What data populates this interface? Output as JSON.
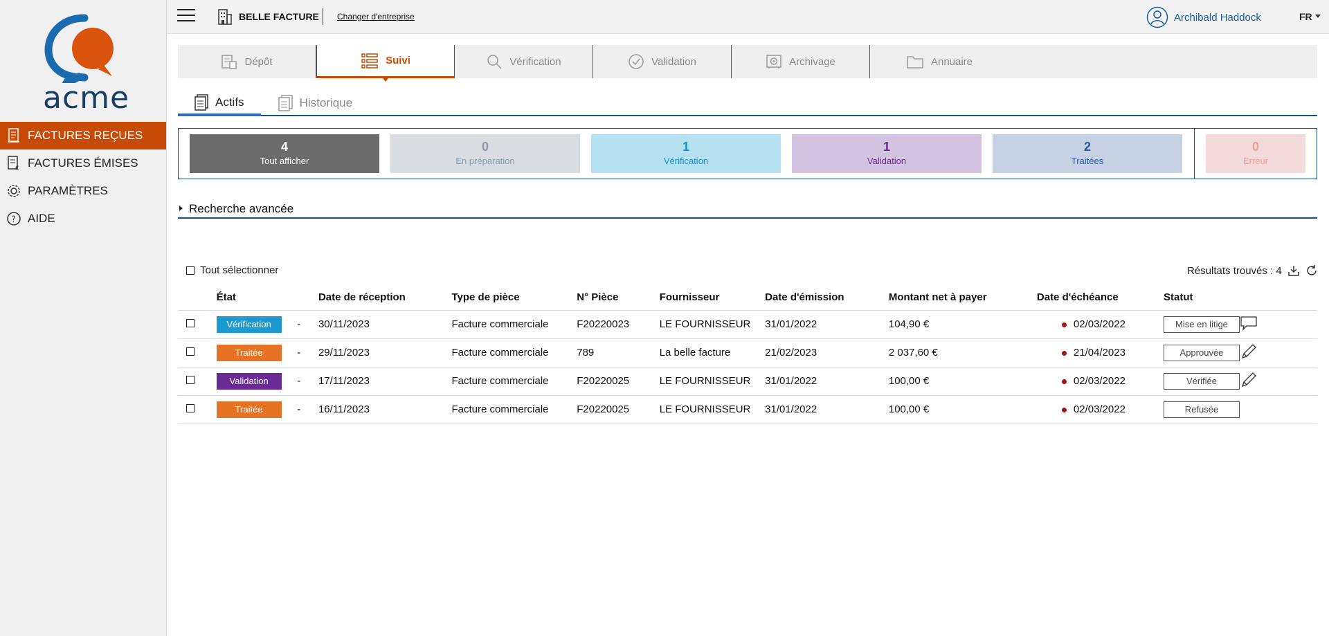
{
  "brand": {
    "logo_text": "acme",
    "logo_orange": "#d9530d",
    "logo_blue": "#1a6ab0"
  },
  "sidebar": {
    "items": [
      {
        "label": "FACTURES REÇUES",
        "icon": "received-invoices-icon",
        "active": true
      },
      {
        "label": "FACTURES ÉMISES",
        "icon": "issued-invoices-icon",
        "active": false
      },
      {
        "label": "PARAMÈTRES",
        "icon": "gear-icon",
        "active": false
      },
      {
        "label": "AIDE",
        "icon": "help-icon",
        "active": false
      }
    ]
  },
  "topbar": {
    "company": "BELLE FACTURE",
    "change_company": "Changer d'entreprise",
    "user": "Archibald Haddock",
    "lang": "FR"
  },
  "module_tabs": [
    {
      "label": "Dépôt",
      "icon": "deposit-icon"
    },
    {
      "label": "Suivi",
      "icon": "tracking-list-icon",
      "active": true
    },
    {
      "label": "Vérification",
      "icon": "search-icon"
    },
    {
      "label": "Validation",
      "icon": "check-circle-icon"
    },
    {
      "label": "Archivage",
      "icon": "safe-icon"
    },
    {
      "label": "Annuaire",
      "icon": "folder-icon"
    }
  ],
  "subtabs": [
    {
      "label": "Actifs",
      "active": true
    },
    {
      "label": "Historique",
      "active": false
    }
  ],
  "counters": [
    {
      "value": "4",
      "label": "Tout afficher",
      "bg": "#6b6b6b",
      "color": "#ffffff"
    },
    {
      "value": "0",
      "label": "En préparation",
      "bg": "#d9dde2",
      "color": "#8a99a8"
    },
    {
      "value": "1",
      "label": "Vérification",
      "bg": "#b4e0f0",
      "color": "#1a8dc8"
    },
    {
      "value": "1",
      "label": "Validation",
      "bg": "#d4c3e0",
      "color": "#6a2a8c"
    },
    {
      "value": "2",
      "label": "Traitées",
      "bg": "#c6d2e4",
      "color": "#2a5a9a"
    },
    {
      "value": "0",
      "label": "Erreur",
      "bg": "#f2dada",
      "color": "#e8a0a0"
    }
  ],
  "search": {
    "label": "Recherche avancée"
  },
  "list": {
    "select_all": "Tout sélectionner",
    "results": "Résultats trouvés : 4",
    "columns": [
      "État",
      "",
      "Date de réception",
      "Type de pièce",
      "N° Pièce",
      "Fournisseur",
      "Date d'émission",
      "Montant net à payer",
      "Date d'échéance",
      "Statut"
    ],
    "rows": [
      {
        "etat": "Vérification",
        "etat_color": "#1a9ad0",
        "dash": "-",
        "reception": "30/11/2023",
        "type": "Facture commerciale",
        "piece": "F20220023",
        "fournisseur": "LE FOURNISSEUR",
        "emission": "31/01/2022",
        "montant": "104,90 €",
        "echeance": "02/03/2022",
        "statut": "Mise en litige",
        "action": "comment-icon"
      },
      {
        "etat": "Traitée",
        "etat_color": "#e67325",
        "dash": "-",
        "reception": "29/11/2023",
        "type": "Facture commerciale",
        "piece": "789",
        "fournisseur": "La belle facture",
        "emission": "21/02/2023",
        "montant": "2 037,60 €",
        "echeance": "21/04/2023",
        "statut": "Approuvée",
        "action": "pencil-icon"
      },
      {
        "etat": "Validation",
        "etat_color": "#6a2a96",
        "dash": "-",
        "reception": "17/11/2023",
        "type": "Facture commerciale",
        "piece": "F20220025",
        "fournisseur": "LE FOURNISSEUR",
        "emission": "31/01/2022",
        "montant": "100,00 €",
        "echeance": "02/03/2022",
        "statut": "Vérifiée",
        "action": "pencil-icon"
      },
      {
        "etat": "Traitée",
        "etat_color": "#e67325",
        "dash": "-",
        "reception": "16/11/2023",
        "type": "Facture commerciale",
        "piece": "F20220025",
        "fournisseur": "LE FOURNISSEUR",
        "emission": "31/01/2022",
        "montant": "100,00 €",
        "echeance": "02/03/2022",
        "statut": "Refusée",
        "action": ""
      }
    ]
  }
}
